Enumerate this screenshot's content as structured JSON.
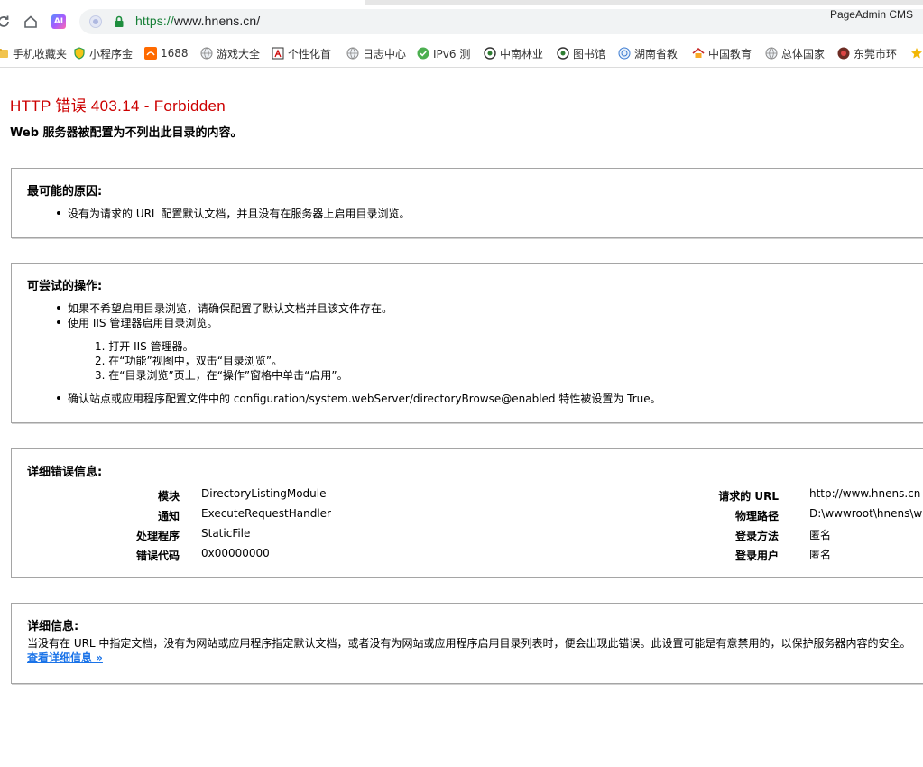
{
  "browser": {
    "url_scheme": "https://",
    "url_rest": "www.hnens.cn/",
    "cms_label": "PageAdmin CMS",
    "ai_badge": "AI",
    "bookmarks": [
      {
        "label": "手机收藏夹",
        "icon": "folder-icon"
      },
      {
        "label": "小程序金",
        "icon": "shield-icon"
      },
      {
        "label": "1688",
        "icon": "1688-logo-icon"
      },
      {
        "label": "游戏大全",
        "icon": "globe-icon"
      },
      {
        "label": "个性化首",
        "icon": "figure-icon"
      },
      {
        "label": "日志中心",
        "icon": "globe-icon"
      },
      {
        "label": "IPv6 测",
        "icon": "check-circle-icon"
      },
      {
        "label": "中南林业",
        "icon": "emblem-icon"
      },
      {
        "label": "图书馆",
        "icon": "emblem-icon"
      },
      {
        "label": "湖南省教",
        "icon": "seal-icon"
      },
      {
        "label": "中国教育",
        "icon": "house-icon"
      },
      {
        "label": "总体国家",
        "icon": "globe-icon"
      },
      {
        "label": "东莞市环",
        "icon": "badge-icon"
      },
      {
        "label": "",
        "icon": "star-icon"
      }
    ]
  },
  "error": {
    "title": "HTTP 错误 403.14 - Forbidden",
    "subtitle": "Web 服务器被配置为不列出此目录的内容。"
  },
  "causes": {
    "heading": "最可能的原因:",
    "items": [
      "没有为请求的 URL 配置默认文档，并且没有在服务器上启用目录浏览。"
    ]
  },
  "actions": {
    "heading": "可尝试的操作:",
    "items": [
      "如果不希望启用目录浏览，请确保配置了默认文档并且该文件存在。",
      "使用 IIS 管理器启用目录浏览。",
      "确认站点或应用程序配置文件中的 configuration/system.webServer/directoryBrowse@enabled 特性被设置为 True。"
    ],
    "steps": [
      "1. 打开 IIS 管理器。",
      "2. 在“功能”视图中，双击“目录浏览”。",
      "3. 在“目录浏览”页上，在“操作”窗格中单击“启用”。"
    ]
  },
  "detailed_error": {
    "heading": "详细错误信息:",
    "left": [
      {
        "label": "模块",
        "value": "DirectoryListingModule"
      },
      {
        "label": "通知",
        "value": "ExecuteRequestHandler"
      },
      {
        "label": "处理程序",
        "value": "StaticFile"
      },
      {
        "label": "错误代码",
        "value": "0x00000000"
      }
    ],
    "right": [
      {
        "label": "请求的 URL",
        "value": "http://www.hnens.cn"
      },
      {
        "label": "物理路径",
        "value": "D:\\wwwroot\\hnens\\w"
      },
      {
        "label": "登录方法",
        "value": "匿名"
      },
      {
        "label": "登录用户",
        "value": "匿名"
      }
    ]
  },
  "more_info": {
    "heading": "详细信息:",
    "text": "当没有在 URL 中指定文档，没有为网站或应用程序指定默认文档，或者没有为网站或应用程序启用目录列表时，便会出现此错误。此设置可能是有意禁用的，以保护服务器内容的安全。",
    "link": "查看详细信息 »"
  }
}
